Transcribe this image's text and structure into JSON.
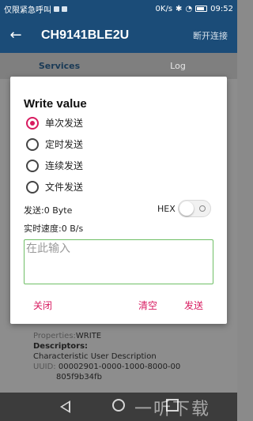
{
  "status_bar": {
    "carrier": "仅限紧急呼叫",
    "net_speed": "0K/s",
    "time": "09:52"
  },
  "app_bar": {
    "title": "CH9141BLE2U",
    "disconnect_label": "断开连接"
  },
  "tabs": [
    {
      "label": "Services"
    },
    {
      "label": "Log"
    }
  ],
  "background_info": {
    "properties_label": "Properties:",
    "properties_value": "WRITE",
    "descriptors_label": "Descriptors:",
    "descriptor_name": "Characteristic User Description",
    "uuid_label": "UUID:",
    "uuid_value": "00002901-0000-1000-8000-00",
    "uuid_value_cont": "805f9b34fb"
  },
  "watermark": "一听下载",
  "dialog": {
    "title": "Write value",
    "send_modes": [
      {
        "label": "单次发送",
        "checked": true
      },
      {
        "label": "定时发送",
        "checked": false
      },
      {
        "label": "连续发送",
        "checked": false
      },
      {
        "label": "文件发送",
        "checked": false
      }
    ],
    "send_count": "发送:0 Byte",
    "hex_label": "HEX",
    "hex_enabled": false,
    "speed": "实时速度:0 B/s",
    "input_placeholder": "在此输入",
    "input_value": "",
    "buttons": {
      "close": "关闭",
      "clear": "清空",
      "send": "发送"
    }
  },
  "colors": {
    "primary": "#1b4c78",
    "accent": "#d81b60",
    "input_border": "#6fbf66"
  }
}
